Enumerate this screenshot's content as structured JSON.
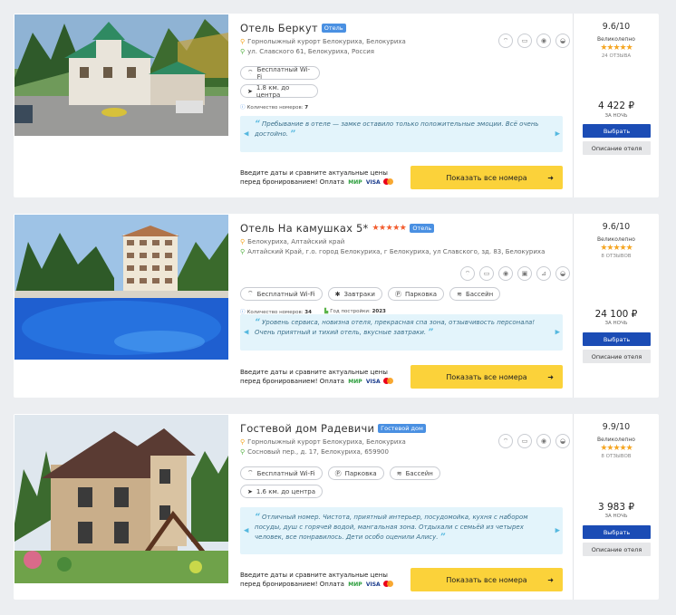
{
  "hotels": [
    {
      "name": "Отель Беркут",
      "stars": "",
      "type": "Отель",
      "region": "Горнолыжный курорт Белокуриха, Белокуриха",
      "address": "ул. Славского 61, Белокуриха, Россия",
      "facility_icons": [
        "wifi-icon",
        "tv-icon",
        "safe-icon",
        "bath-icon"
      ],
      "tags": [
        {
          "icon": "wifi-icon",
          "glyph": "⌔",
          "label": "Бесплатный Wi-Fi"
        },
        {
          "icon": "navigation-icon",
          "glyph": "➤",
          "label": "1.8 км. до центра"
        }
      ],
      "rooms_label": "Количество номеров:",
      "rooms_value": "7",
      "built_label": "",
      "built_value": "",
      "review": "Пребывание в отеле — замке оставило только положительные эмоции. Всё очень достойно.",
      "cta_text": "Введите даты и сравните актуальные цены перед бронированием! Оплата",
      "show_button": "Показать все номера",
      "rating": "9.6/10",
      "rating_label": "Великолепно",
      "rating_stars": "★★★★★",
      "reviews_count": "24 ОТЗЫВА",
      "price": "4 422 ₽",
      "per_night": "ЗА НОЧЬ",
      "select_button": "Выбрать",
      "description_button": "Описание отеля"
    },
    {
      "name": "Отель На камушках 5*",
      "stars": "★★★★★",
      "type": "Отель",
      "region": "Белокуриха, Алтайский край",
      "address": "Алтайский Край, г.о. город Белокуриха, г Белокуриха, ул Славского, зд. 83, Белокуриха",
      "facility_icons": [
        "wifi-icon",
        "tv-icon",
        "safe-icon",
        "minibar-icon",
        "iron-icon",
        "bath-icon"
      ],
      "tags": [
        {
          "icon": "wifi-icon",
          "glyph": "⌔",
          "label": "Бесплатный Wi-Fi"
        },
        {
          "icon": "breakfast-icon",
          "glyph": "✱",
          "label": "Завтраки"
        },
        {
          "icon": "parking-icon",
          "glyph": "Ⓟ",
          "label": "Парковка"
        },
        {
          "icon": "pool-icon",
          "glyph": "≋",
          "label": "Бассейн"
        }
      ],
      "rooms_label": "Количество номеров:",
      "rooms_value": "34",
      "built_label": "Год постройки:",
      "built_value": "2023",
      "review": "Уровень сервиса, новизна отеля, прекрасная спа зона, отзывчивость персонала! Очень приятный и тихий отель, вкусные завтраки.",
      "cta_text": "Введите даты и сравните актуальные цены перед бронированием! Оплата",
      "show_button": "Показать все номера",
      "rating": "9.6/10",
      "rating_label": "Великолепно",
      "rating_stars": "★★★★★",
      "reviews_count": "8 ОТЗЫВОВ",
      "price": "24 100 ₽",
      "per_night": "ЗА НОЧЬ",
      "select_button": "Выбрать",
      "description_button": "Описание отеля"
    },
    {
      "name": "Гостевой дом Радевичи",
      "stars": "",
      "type": "Гостевой дом",
      "region": "Горнолыжный курорт Белокуриха, Белокуриха",
      "address": "Сосновый пер., д. 17, Белокуриха, 659900",
      "facility_icons": [
        "wifi-icon",
        "tv-icon",
        "safe-icon",
        "bath-icon"
      ],
      "tags": [
        {
          "icon": "wifi-icon",
          "glyph": "⌔",
          "label": "Бесплатный Wi-Fi"
        },
        {
          "icon": "parking-icon",
          "glyph": "Ⓟ",
          "label": "Парковка"
        },
        {
          "icon": "pool-icon",
          "glyph": "≋",
          "label": "Бассейн"
        },
        {
          "icon": "navigation-icon",
          "glyph": "➤",
          "label": "1.6 км. до центра"
        }
      ],
      "rooms_label": "",
      "rooms_value": "",
      "built_label": "",
      "built_value": "",
      "review": "Отличный номер. Чистота, приятный интерьер, посудомойка, кухня с набором посуды, душ с горячей водой, мангальная зона. Отдыхали с семьёй из четырех человек, все понравилось. Дети особо оценили Алису.",
      "cta_text": "Введите даты и сравните актуальные цены перед бронированием! Оплата",
      "show_button": "Показать все номера",
      "rating": "9.9/10",
      "rating_label": "Великолепно",
      "rating_stars": "★★★★★",
      "reviews_count": "8 ОТЗЫВОВ",
      "price": "3 983 ₽",
      "per_night": "ЗА НОЧЬ",
      "select_button": "Выбрать",
      "description_button": "Описание отеля"
    }
  ],
  "payment": {
    "mir": "МИР",
    "visa": "VISA"
  },
  "colors": {
    "accent_yellow": "#fbd23a",
    "select_blue": "#1b4cb5",
    "badge_blue": "#4a90e2",
    "review_bg": "#e3f4fb"
  }
}
